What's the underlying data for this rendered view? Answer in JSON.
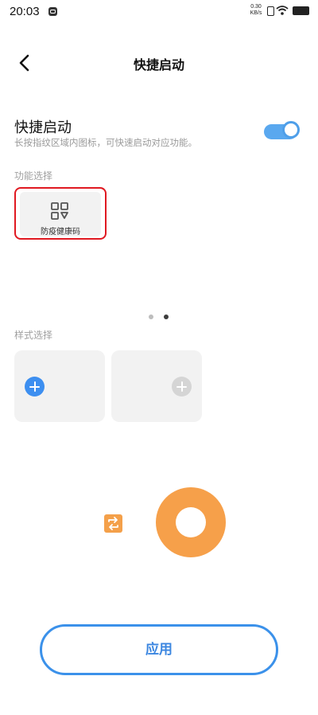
{
  "status_bar": {
    "time": "20:03",
    "net_speed_value": "0.30",
    "net_speed_unit": "KB/s"
  },
  "header": {
    "title": "快捷启动"
  },
  "quick_launch": {
    "title": "快捷启动",
    "description": "长按指纹区域内图标，可快速启动对应功能。",
    "enabled": true
  },
  "function_select": {
    "label": "功能选择",
    "items": [
      {
        "label": "防疫健康码",
        "icon": "grid-icon",
        "selected": true
      }
    ],
    "page_count": 2,
    "current_page": 2
  },
  "style_select": {
    "label": "样式选择",
    "options": [
      {
        "icon": "plus-icon",
        "accent": "#3d8ff0"
      },
      {
        "icon": "plus-icon",
        "accent": "#d5d5d5"
      }
    ]
  },
  "preview": {
    "accent": "#f6a04a"
  },
  "apply_button": {
    "label": "应用"
  },
  "colors": {
    "primary": "#3b91ea",
    "highlight": "#e01921",
    "orange": "#f6a04a"
  }
}
